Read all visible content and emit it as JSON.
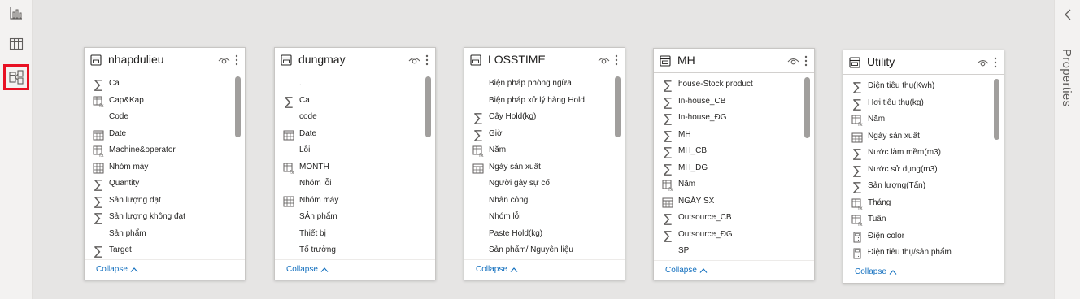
{
  "nav": {
    "items": [
      {
        "icon": "report-view-icon",
        "active": false
      },
      {
        "icon": "data-view-icon",
        "active": false
      },
      {
        "icon": "model-view-icon",
        "active": true
      }
    ]
  },
  "properties_panel": {
    "title": "Properties",
    "toggle_icon": "chevron-left-icon"
  },
  "tables": [
    {
      "name": "nhapdulieu",
      "collapse_label": "Collapse",
      "fields": [
        {
          "icon": "sigma",
          "label": "Ca"
        },
        {
          "icon": "calc-table",
          "label": "Cap&Kap"
        },
        {
          "icon": "none",
          "label": "Code"
        },
        {
          "icon": "calendar",
          "label": "Date"
        },
        {
          "icon": "calc-table",
          "label": "Machine&operator"
        },
        {
          "icon": "hierarchy",
          "label": "Nhóm máy"
        },
        {
          "icon": "sigma",
          "label": "Quantity"
        },
        {
          "icon": "sigma",
          "label": "Sản lượng đạt"
        },
        {
          "icon": "sigma",
          "label": "Sản lượng không đạt"
        },
        {
          "icon": "none",
          "label": "Sản phẩm"
        },
        {
          "icon": "sigma",
          "label": "Target"
        }
      ]
    },
    {
      "name": "dungmay",
      "collapse_label": "Collapse",
      "fields": [
        {
          "icon": "none",
          "label": "."
        },
        {
          "icon": "sigma",
          "label": "Ca"
        },
        {
          "icon": "none",
          "label": "code"
        },
        {
          "icon": "calendar",
          "label": "Date"
        },
        {
          "icon": "none",
          "label": "Lỗi"
        },
        {
          "icon": "calc-table",
          "label": "MONTH"
        },
        {
          "icon": "none",
          "label": "Nhóm lỗi"
        },
        {
          "icon": "hierarchy",
          "label": "Nhóm máy"
        },
        {
          "icon": "none",
          "label": "SẢn phẩm"
        },
        {
          "icon": "none",
          "label": "Thiết bị"
        },
        {
          "icon": "none",
          "label": "Tổ trưởng"
        }
      ]
    },
    {
      "name": "LOSSTIME",
      "collapse_label": "Collapse",
      "fields": [
        {
          "icon": "none",
          "label": "Biện pháp phòng ngừa"
        },
        {
          "icon": "none",
          "label": "Biện pháp xử lý hàng Hold"
        },
        {
          "icon": "sigma",
          "label": "Cây Hold(kg)"
        },
        {
          "icon": "sigma",
          "label": "Giờ"
        },
        {
          "icon": "calc-table",
          "label": "Năm"
        },
        {
          "icon": "calendar",
          "label": "Ngày sản xuất"
        },
        {
          "icon": "none",
          "label": "Người gây sự cố"
        },
        {
          "icon": "none",
          "label": "Nhân công"
        },
        {
          "icon": "none",
          "label": "Nhóm lỗi"
        },
        {
          "icon": "none",
          "label": "Paste Hold(kg)"
        },
        {
          "icon": "none",
          "label": "Sản phẩm/ Nguyên liệu"
        }
      ]
    },
    {
      "name": "MH",
      "collapse_label": "Collapse",
      "fields": [
        {
          "icon": "sigma",
          "label": "house-Stock product"
        },
        {
          "icon": "sigma",
          "label": "In-house_CB"
        },
        {
          "icon": "sigma",
          "label": "In-house_ĐG"
        },
        {
          "icon": "sigma",
          "label": "MH"
        },
        {
          "icon": "sigma",
          "label": "MH_CB"
        },
        {
          "icon": "sigma",
          "label": "MH_DG"
        },
        {
          "icon": "calc-table",
          "label": "Năm"
        },
        {
          "icon": "calendar",
          "label": "NGÀY SX"
        },
        {
          "icon": "sigma",
          "label": "Outsource_CB"
        },
        {
          "icon": "sigma",
          "label": "Outsource_ĐG"
        },
        {
          "icon": "none",
          "label": "SP"
        }
      ]
    },
    {
      "name": "Utility",
      "collapse_label": "Collapse",
      "fields": [
        {
          "icon": "sigma",
          "label": "Điện tiêu thụ(Kwh)"
        },
        {
          "icon": "sigma",
          "label": "Hơi tiêu thụ(kg)"
        },
        {
          "icon": "calc-table",
          "label": "Năm"
        },
        {
          "icon": "calendar",
          "label": "Ngày sản xuất"
        },
        {
          "icon": "sigma",
          "label": "Nước làm mềm(m3)"
        },
        {
          "icon": "sigma",
          "label": "Nước sử dụng(m3)"
        },
        {
          "icon": "sigma",
          "label": "Sản lượng(Tấn)"
        },
        {
          "icon": "calc-table",
          "label": "Tháng"
        },
        {
          "icon": "calc-table",
          "label": "Tuần"
        },
        {
          "icon": "calculator",
          "label": "Điện color"
        },
        {
          "icon": "calculator",
          "label": "Điện tiêu thụ/sản phẩm"
        }
      ]
    }
  ],
  "colors": {
    "accent": "#106ebe",
    "highlight": "#e81123",
    "canvas": "#e6e5e4"
  }
}
